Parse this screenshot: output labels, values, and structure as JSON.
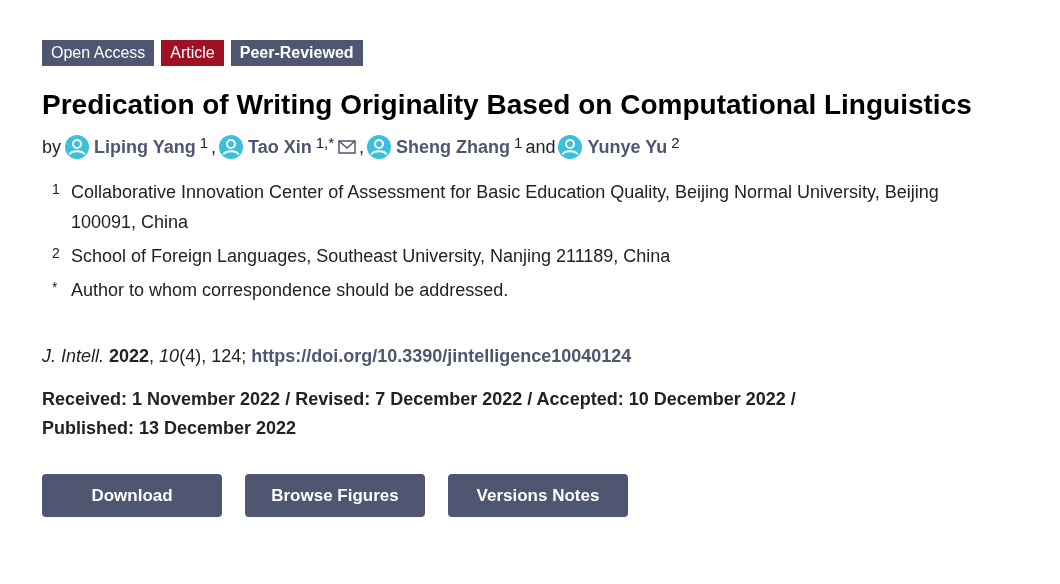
{
  "badges": [
    {
      "label": "Open Access",
      "color": "#4f5671",
      "bold": false
    },
    {
      "label": "Article",
      "color": "#a01024",
      "bold": false
    },
    {
      "label": "Peer-Reviewed",
      "color": "#4f5671",
      "bold": true
    }
  ],
  "title": "Predication of Writing Originality Based on Computational Linguistics",
  "authors_prefix": "by",
  "authors": [
    {
      "name": "Liping Yang",
      "note": "1",
      "email": false,
      "joiner": ","
    },
    {
      "name": "Tao Xin",
      "note": "1,*",
      "email": true,
      "joiner": ","
    },
    {
      "name": "Sheng Zhang",
      "note": "1",
      "email": false,
      "joiner": "and"
    },
    {
      "name": "Yunye Yu",
      "note": "2",
      "email": false
    }
  ],
  "affiliations": [
    {
      "mark": "1",
      "text": "Collaborative Innovation Center of Assessment for Basic Education Quality, Beijing Normal University, Beijing 100091, China"
    },
    {
      "mark": "2",
      "text": "School of Foreign Languages, Southeast University, Nanjing 211189, China"
    },
    {
      "mark": "*",
      "text": "Author to whom correspondence should be addressed."
    }
  ],
  "citation": {
    "text": "*J. Intell.* **2022**, *10*(4), 124;",
    "doi": "https://doi.org/10.3390/jintelligence10040124"
  },
  "dates": "Received: 1 November 2022 / Revised: 7 December 2022 / Accepted: 10 December 2022 / Published: 13 December 2022",
  "buttons": [
    "Download",
    "Browse Figures",
    "Versions Notes"
  ]
}
